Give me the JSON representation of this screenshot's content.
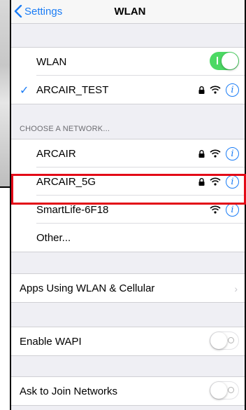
{
  "nav": {
    "back_label": "Settings",
    "title": "WLAN"
  },
  "wlan_toggle": {
    "label": "WLAN",
    "on": true
  },
  "connected": {
    "name": "ARCAIR_TEST"
  },
  "section_header": "CHOOSE A NETWORK...",
  "networks": [
    {
      "name": "ARCAIR",
      "locked": true
    },
    {
      "name": "ARCAIR_5G",
      "locked": true
    },
    {
      "name": "SmartLife-6F18",
      "locked": false
    },
    {
      "name": "Other..."
    }
  ],
  "apps_using": {
    "label": "Apps Using WLAN & Cellular"
  },
  "enable_wapi": {
    "label": "Enable WAPI",
    "on": false
  },
  "ask_to_join": {
    "label": "Ask to Join Networks",
    "on": false
  },
  "colors": {
    "accent": "#1a7cf5",
    "toggle_on": "#4cd964",
    "highlight": "#e30a17"
  },
  "icons": [
    "chevron-left-icon",
    "checkmark-icon",
    "lock-icon",
    "wifi-icon",
    "info-icon",
    "chevron-right-icon"
  ]
}
